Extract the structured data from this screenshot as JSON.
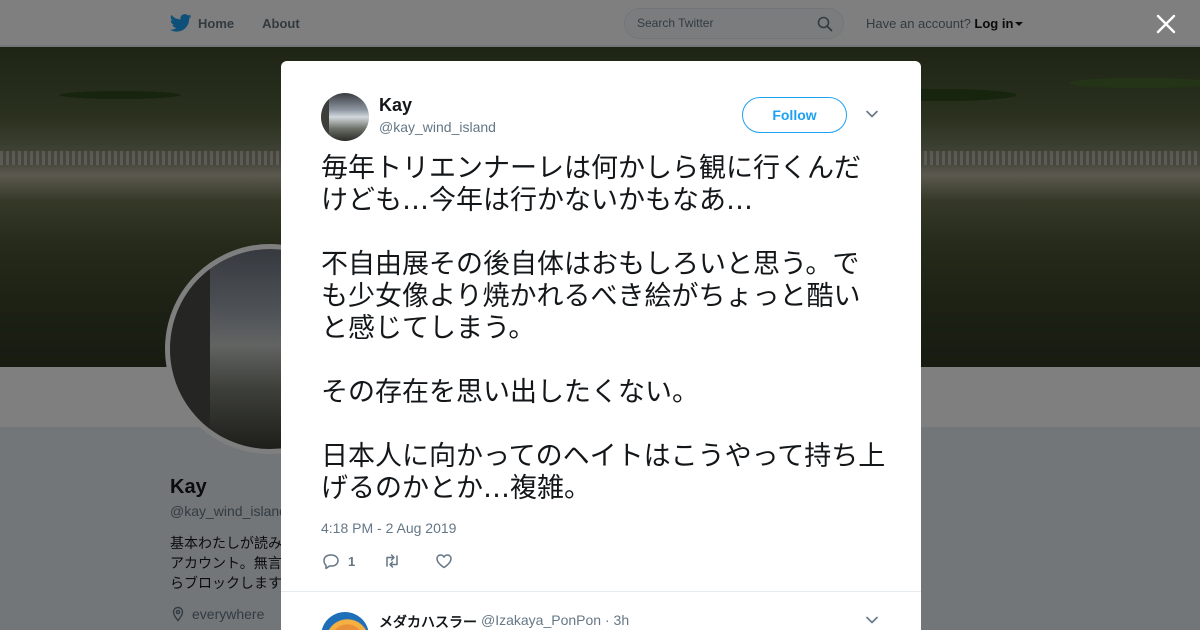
{
  "nav": {
    "home_label": "Home",
    "about_label": "About",
    "search_placeholder": "Search Twitter",
    "account_prompt": "Have an account?",
    "login_label": "Log in"
  },
  "profile": {
    "name": "Kay",
    "handle": "@kay_wind_island",
    "bio": "基本わたしが読み\nアカウント。無言\nらブロックします",
    "location": "everywhere"
  },
  "tweet": {
    "author_name": "Kay",
    "author_handle": "@kay_wind_island",
    "follow_label": "Follow",
    "paragraphs": [
      "毎年トリエンナーレは何かしら観に行くんだけども…今年は行かないかもなあ…",
      "不自由展その後自体はおもしろいと思う。でも少女像より焼かれるべき絵がちょっと酷いと感じてしまう。",
      "その存在を思い出したくない。",
      "日本人に向かってのヘイトはこうやって持ち上げるのかとか…複雑。"
    ],
    "timestamp": "4:18 PM - 2 Aug 2019",
    "reply_count": "1"
  },
  "reply": {
    "name": "メダカハスラー",
    "handle": "@Izakaya_PonPon",
    "time": "3h"
  },
  "colors": {
    "accent": "#1da1f2",
    "secondary_text": "#657786"
  },
  "icons": [
    "twitter-bird-icon",
    "search-icon",
    "close-icon",
    "chevron-down-icon",
    "reply-icon",
    "retweet-icon",
    "heart-icon",
    "location-pin-icon"
  ]
}
